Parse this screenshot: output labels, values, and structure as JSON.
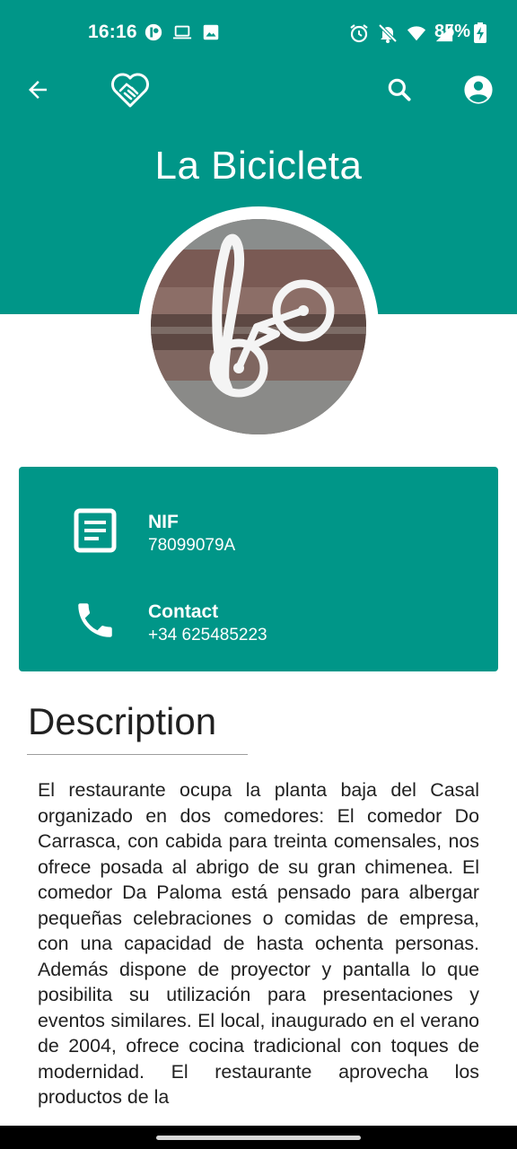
{
  "status_bar": {
    "time": "16:16",
    "battery_percent": "85%",
    "left_icons": [
      "app-notification-icon",
      "laptop-icon",
      "image-icon"
    ],
    "right_icons": [
      "alarm-icon",
      "mute-icon",
      "wifi-icon",
      "signal-icon",
      "battery-charging-icon"
    ]
  },
  "app_bar": {
    "back_icon": "arrow-back-icon",
    "logo_icon": "heart-handshake-logo",
    "search_icon": "search-icon",
    "account_icon": "account-circle-icon"
  },
  "page": {
    "title": "La Bicicleta"
  },
  "info_card": {
    "nif_label": "NIF",
    "nif_value": "78099079A",
    "contact_label": "Contact",
    "contact_value": "+34 625485223"
  },
  "description": {
    "heading": "Description",
    "text": "El restaurante ocupa la planta baja del Casal organizado en dos comedores: El comedor Do Carrasca, con cabida para treinta comensales, nos ofrece posada al abrigo de su gran chimenea. El comedor Da Paloma está pensado para albergar pequeñas celebraciones o comidas de empresa, con una capacidad de hasta ochenta personas. Además dispone de proyector y pantalla lo que posibilita su utilización para presentaciones y eventos similares. El local, inaugurado en el verano de 2004, ofrece cocina tradicional con toques de modernidad. El restaurante aprovecha los productos de la"
  },
  "colors": {
    "primary": "#009688",
    "on_primary": "#ffffff",
    "text": "#212121"
  }
}
